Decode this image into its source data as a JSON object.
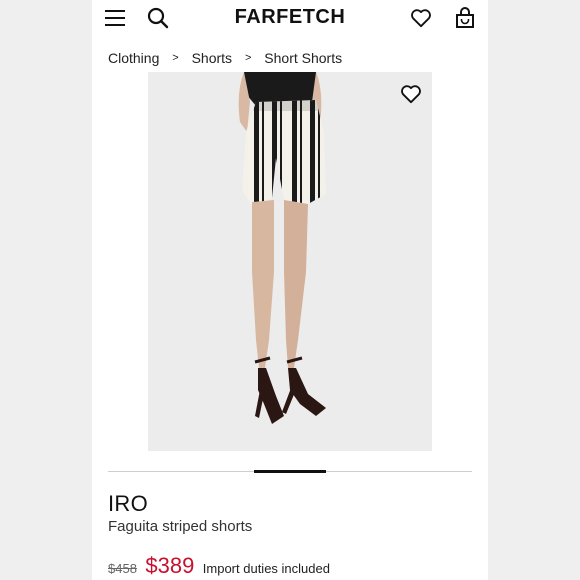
{
  "header": {
    "logo": "FARFETCH",
    "icons": [
      "menu-icon",
      "search-icon",
      "wishlist-icon",
      "bag-icon"
    ]
  },
  "breadcrumb": {
    "items": [
      "Clothing",
      "Shorts",
      "Short Shorts"
    ],
    "separator": ">"
  },
  "product": {
    "brand": "IRO",
    "name": "Faguita striped shorts",
    "original_price": "$458",
    "sale_price": "$389",
    "duties_note": "Import duties included",
    "image_alt": "Model wearing black and white striped high-waisted shorts with black strappy heeled sandals"
  },
  "gallery": {
    "indicator_fraction": 0.2
  },
  "colors": {
    "sale_price": "#c8102e",
    "text": "#111111",
    "background": "#ffffff"
  }
}
